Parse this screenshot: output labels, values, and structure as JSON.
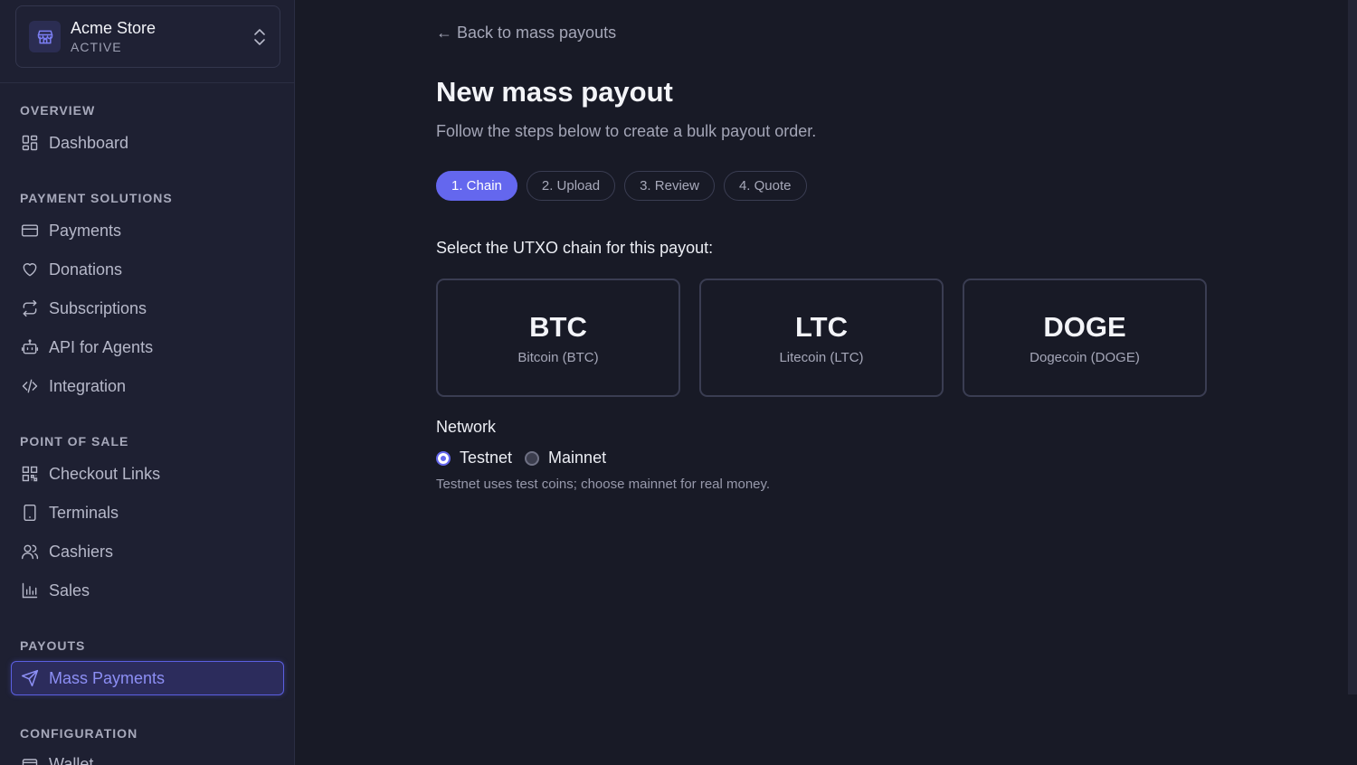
{
  "store": {
    "name": "Acme Store",
    "status": "ACTIVE"
  },
  "sidebar": {
    "sections": {
      "overview": "OVERVIEW",
      "payment_solutions": "PAYMENT SOLUTIONS",
      "point_of_sale": "POINT OF SALE",
      "payouts": "PAYOUTS",
      "configuration": "CONFIGURATION"
    },
    "items": {
      "dashboard": "Dashboard",
      "payments": "Payments",
      "donations": "Donations",
      "subscriptions": "Subscriptions",
      "api_for_agents": "API for Agents",
      "integration": "Integration",
      "checkout_links": "Checkout Links",
      "terminals": "Terminals",
      "cashiers": "Cashiers",
      "sales": "Sales",
      "mass_payments": "Mass Payments",
      "wallet": "Wallet"
    },
    "active_item": "mass_payments",
    "accent_color": "#6467ee"
  },
  "main": {
    "back_link": "← Back to mass payouts",
    "title": "New mass payout",
    "subtitle": "Follow the steps below to create a bulk payout order.",
    "steps": [
      "1. Chain",
      "2. Upload",
      "3. Review",
      "4. Quote"
    ],
    "active_step": 0,
    "select_label": "Select the UTXO chain for this payout:",
    "chains": [
      {
        "code": "BTC",
        "name": "Bitcoin (BTC)"
      },
      {
        "code": "LTC",
        "name": "Litecoin (LTC)"
      },
      {
        "code": "DOGE",
        "name": "Dogecoin (DOGE)"
      }
    ],
    "network": {
      "label": "Network",
      "options": [
        "Testnet",
        "Mainnet"
      ],
      "selected": "Testnet",
      "hint": "Testnet uses test coins; choose mainnet for real money."
    }
  }
}
